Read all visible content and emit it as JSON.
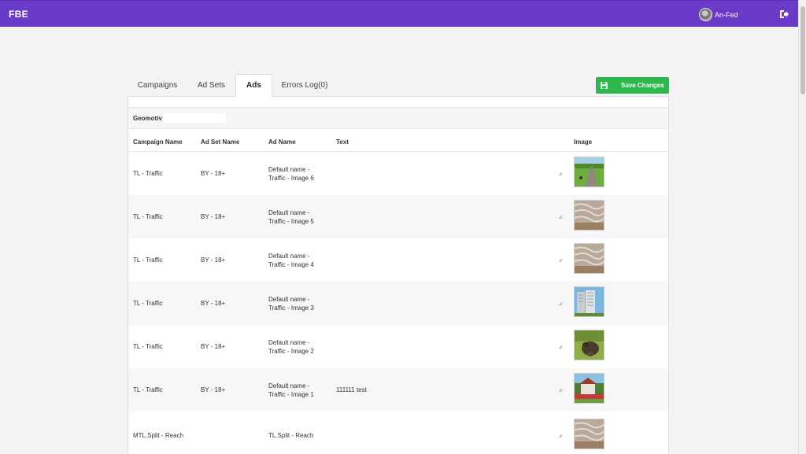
{
  "app": {
    "brand": "FBE"
  },
  "user": {
    "name": "An-Fed"
  },
  "tabs": [
    {
      "label": "Campaigns",
      "active": false
    },
    {
      "label": "Ad Sets",
      "active": false
    },
    {
      "label": "Ads",
      "active": true
    },
    {
      "label": "Errors Log(0)",
      "active": false
    }
  ],
  "actions": {
    "save_label": "Save Changes",
    "save_color": "#2db84d"
  },
  "account": {
    "name": "Geomotiv"
  },
  "table": {
    "headers": {
      "campaign": "Campaign Name",
      "adset": "Ad Set Name",
      "adname": "Ad Name",
      "text": "Text",
      "image": "Image"
    },
    "rows": [
      {
        "campaign": "TL - Traffic",
        "adset": "BY - 18+",
        "adname_l1": "Default name -",
        "adname_l2": "Traffic - Image 6",
        "text": "",
        "image": "field-road-photo"
      },
      {
        "campaign": "TL - Traffic",
        "adset": "BY - 18+",
        "adname_l1": "Default name -",
        "adname_l2": "Traffic - Image 5",
        "text": "",
        "image": "dune-texture-photo"
      },
      {
        "campaign": "TL - Traffic",
        "adset": "BY - 18+",
        "adname_l1": "Default name -",
        "adname_l2": "Traffic - Image 4",
        "text": "",
        "image": "dune-texture-photo"
      },
      {
        "campaign": "TL - Traffic",
        "adset": "BY - 18+",
        "adname_l1": "Default name -",
        "adname_l2": "Traffic - Image 3",
        "text": "",
        "image": "building-photo"
      },
      {
        "campaign": "TL - Traffic",
        "adset": "BY - 18+",
        "adname_l1": "Default name -",
        "adname_l2": "Traffic - Image 2",
        "text": "",
        "image": "boar-photo"
      },
      {
        "campaign": "TL - Traffic",
        "adset": "BY - 18+",
        "adname_l1": "Default name -",
        "adname_l2": "Traffic - Image 1",
        "text": "111111 test",
        "image": "house-garden-photo"
      },
      {
        "campaign": "MTL.Split - Reach",
        "adset": "",
        "adname_l1": "TL.Split - Reach",
        "adname_l2": "",
        "text": "",
        "image": "dune-texture-photo"
      }
    ]
  },
  "colors": {
    "topbar": "#6a3ac8",
    "save": "#2db84d"
  }
}
